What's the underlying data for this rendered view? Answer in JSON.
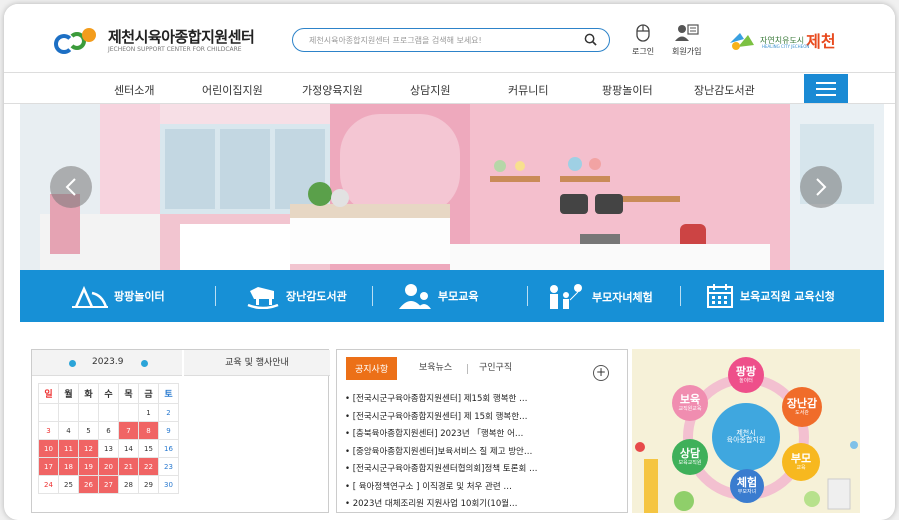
{
  "header": {
    "logo_title": "제천시육아종합지원센터",
    "logo_sub": "JECHEON SUPPORT CENTER FOR CHILDCARE",
    "search_placeholder": "제천시육아종합지원센터 프로그램을 검색해 보세요!",
    "login_label": "로그인",
    "signup_label": "회원가입",
    "city_slogan": "자연치유도시",
    "city_name": "제천",
    "city_sub": "HEALING CITY JECHEON"
  },
  "nav": {
    "items": [
      "센터소개",
      "어린이집지원",
      "가정양육지원",
      "상담지원",
      "커뮤니티",
      "팡팡놀이터",
      "장난감도서관"
    ]
  },
  "quick": {
    "items": [
      "팡팡놀이터",
      "장난감도서관",
      "부모교육",
      "부모자녀체험",
      "보육교직원 교육신청"
    ]
  },
  "calendar": {
    "month": "2023.9",
    "title": "교육 및 행사안내",
    "weekdays": [
      "일",
      "월",
      "화",
      "수",
      "목",
      "금",
      "토"
    ],
    "weeks": [
      [
        "",
        "",
        "",
        "",
        "",
        "1",
        "2"
      ],
      [
        "3",
        "4",
        "5",
        "6",
        "7",
        "8",
        "9"
      ],
      [
        "10",
        "11",
        "12",
        "13",
        "14",
        "15",
        "16"
      ],
      [
        "17",
        "18",
        "19",
        "20",
        "21",
        "22",
        "23"
      ],
      [
        "24",
        "25",
        "26",
        "27",
        "28",
        "29",
        "30"
      ]
    ],
    "highlighted": [
      "7",
      "8",
      "10",
      "11",
      "12",
      "17",
      "18",
      "19",
      "20",
      "21",
      "22",
      "26",
      "27"
    ]
  },
  "notice": {
    "tabs": [
      "공지사항",
      "보육뉴스",
      "구인구직"
    ],
    "items": [
      "• [전국시군구육아종합지원센터] 제15회 행복한 …",
      "• [전국시군구육아종합지원센터] 제 15회 행복한…",
      "• [충북육아종합지원센터] 2023년 「행복한 어…",
      "• [중앙육아종합지원센터]보육서비스 질 제고 방안…",
      "• [전국시군구육아종합지원센터협의회]정책 토론회 …",
      "• [ 육아정책연구소 ] 이직경로 및 처우 관련 …",
      "• 2023년 대체조리원 지원사업 10회기(10월…"
    ]
  },
  "promo": {
    "center_label": "제천시\n육아종합지원",
    "bubbles": [
      {
        "t1": "팡팡",
        "t2": "놀이터"
      },
      {
        "t1": "장난감",
        "t2": "도서관"
      },
      {
        "t1": "부모",
        "t2": "교육"
      },
      {
        "t1": "체험",
        "t2": "부모자녀"
      },
      {
        "t1": "상담",
        "t2": "보육교직원"
      },
      {
        "t1": "보육",
        "t2": "교직원교육"
      }
    ]
  },
  "colors": {
    "brand_blue": "#1790d6",
    "accent_orange": "#ec7018",
    "cal_red": "#f06464"
  }
}
